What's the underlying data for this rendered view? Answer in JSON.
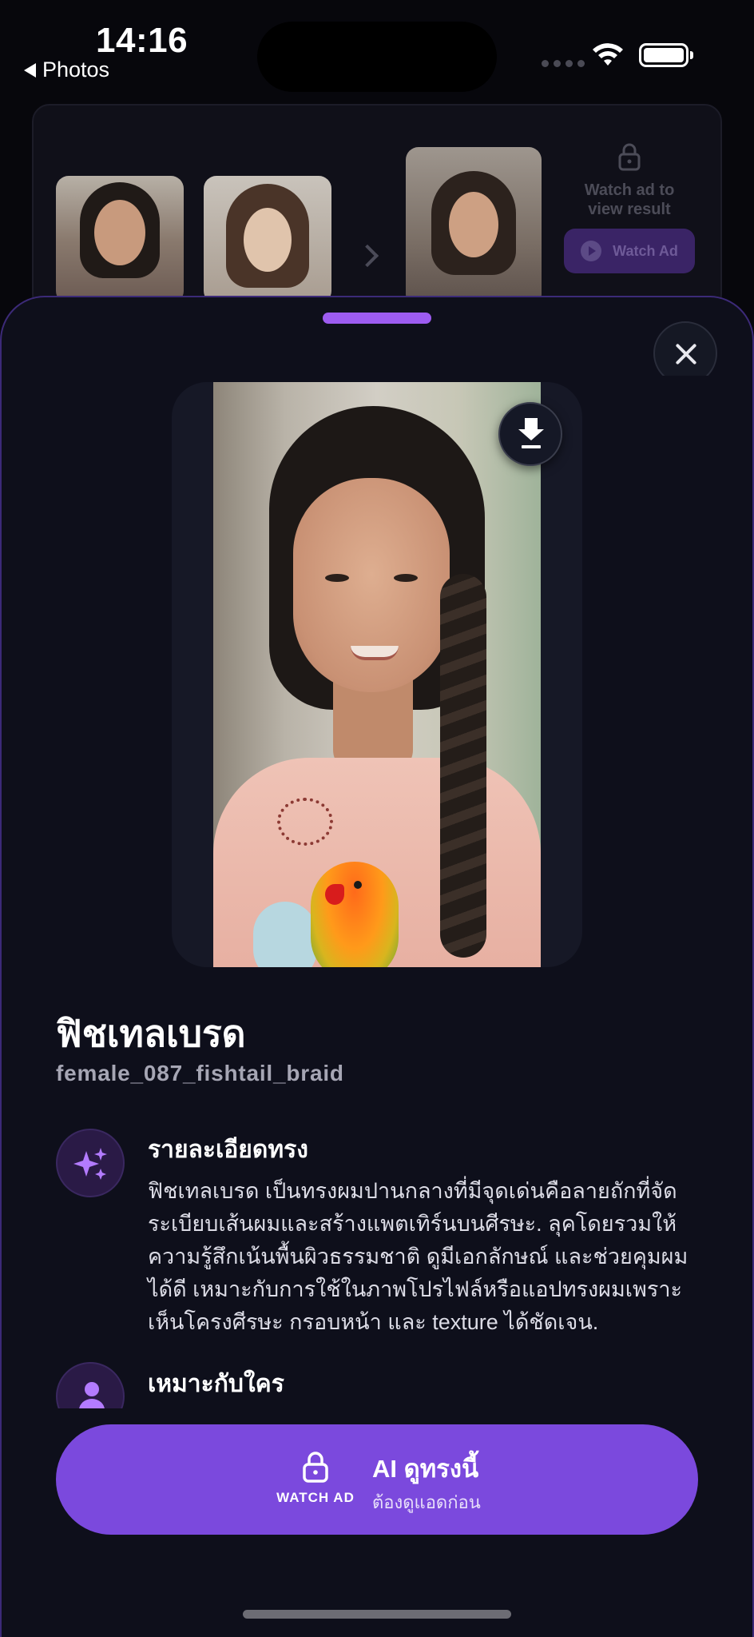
{
  "status_bar": {
    "time": "14:16",
    "back_label": "Photos",
    "icons": [
      "back-triangle-icon",
      "signal-icon",
      "wifi-icon",
      "battery-icon"
    ]
  },
  "background_card": {
    "caption": "",
    "watch_ad_prompt": "Watch ad to view result",
    "watch_ad_button": "Watch Ad",
    "icons": [
      "lock-icon",
      "chevron-right-icon",
      "play-icon"
    ]
  },
  "sheet": {
    "style_name": "ฟิชเทลเบรด",
    "style_code": "female_087_fishtail_braid",
    "sections": [
      {
        "title": "รายละเอียดทรง",
        "icon": "sparkles-icon",
        "body": "ฟิชเทลเบรด เป็นทรงผมปานกลางที่มีจุดเด่นคือลายถักที่จัดระเบียบเส้นผมและสร้างแพตเทิร์นบนศีรษะ. ลุคโดยรวมให้ความรู้สึกเน้นพื้นผิวธรรมชาติ ดูมีเอกลักษณ์ และช่วยคุมผมได้ดี เหมาะกับการใช้ในภาพโปรไฟล์หรือแอปทรงผมเพราะเห็นโครงศีรษะ กรอบหน้า และ texture ได้ชัดเจน."
      },
      {
        "title": "เหมาะกับใคร",
        "icon": "person-icon"
      }
    ],
    "cta": {
      "watch_label": "WATCH AD",
      "title": "AI ดูทรงนี้",
      "subtitle": "ต้องดูแอดก่อน",
      "icon": "lock-icon"
    }
  },
  "colors": {
    "background": "#07070c",
    "sheet": "#0e0f1b",
    "accent": "#7b49dd",
    "grabber": "#9d5cf0",
    "icon_accent": "#b37bff"
  }
}
